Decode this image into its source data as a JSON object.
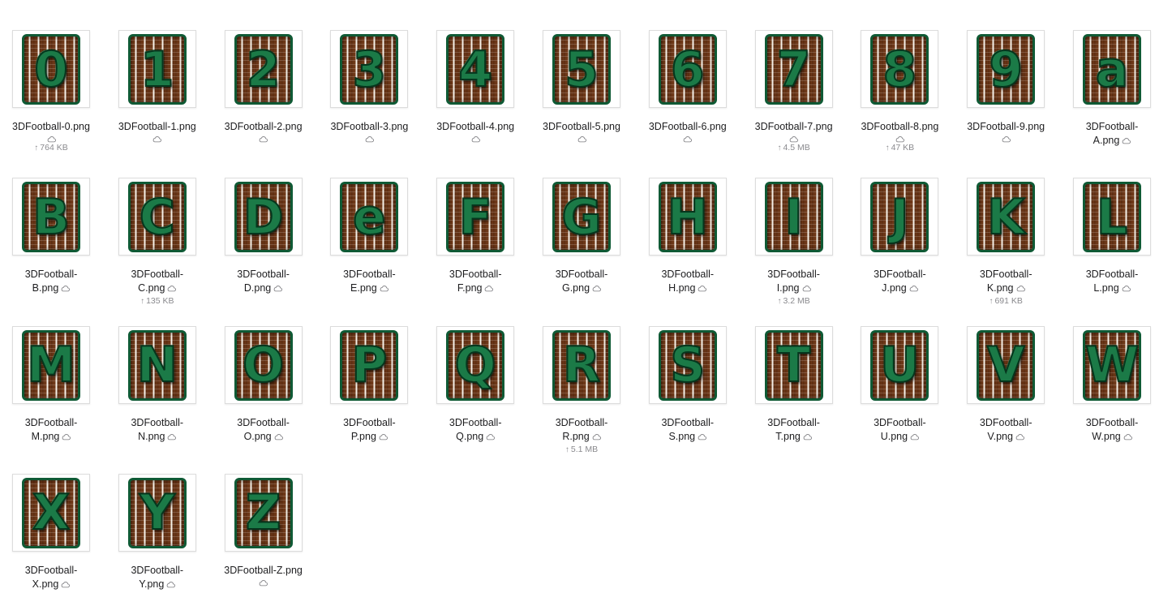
{
  "window": {
    "view": "icon-grid"
  },
  "colors": {
    "tile_green": "#1b7a47",
    "tile_brown": "#6e3818",
    "stitch": "#f5efe6",
    "meta_text": "#8a8a8e"
  },
  "icons": {
    "cloud": "cloud-icon",
    "upload": "upload-arrow-icon"
  },
  "files": [
    {
      "glyph": "0",
      "name": "3DFootball-0.png",
      "name_line1": "3DFootball-0.png",
      "name_line2": "",
      "size": "764 KB"
    },
    {
      "glyph": "1",
      "name": "3DFootball-1.png",
      "name_line1": "3DFootball-1.png",
      "name_line2": "",
      "size": ""
    },
    {
      "glyph": "2",
      "name": "3DFootball-2.png",
      "name_line1": "3DFootball-2.png",
      "name_line2": "",
      "size": ""
    },
    {
      "glyph": "3",
      "name": "3DFootball-3.png",
      "name_line1": "3DFootball-3.png",
      "name_line2": "",
      "size": ""
    },
    {
      "glyph": "4",
      "name": "3DFootball-4.png",
      "name_line1": "3DFootball-4.png",
      "name_line2": "",
      "size": ""
    },
    {
      "glyph": "5",
      "name": "3DFootball-5.png",
      "name_line1": "3DFootball-5.png",
      "name_line2": "",
      "size": ""
    },
    {
      "glyph": "6",
      "name": "3DFootball-6.png",
      "name_line1": "3DFootball-6.png",
      "name_line2": "",
      "size": ""
    },
    {
      "glyph": "7",
      "name": "3DFootball-7.png",
      "name_line1": "3DFootball-7.png",
      "name_line2": "",
      "size": "4.5 MB"
    },
    {
      "glyph": "8",
      "name": "3DFootball-8.png",
      "name_line1": "3DFootball-8.png",
      "name_line2": "",
      "size": "47 KB"
    },
    {
      "glyph": "9",
      "name": "3DFootball-9.png",
      "name_line1": "3DFootball-9.png",
      "name_line2": "",
      "size": ""
    },
    {
      "glyph": "a",
      "name": "3DFootball-A.png",
      "name_line1": "3DFootball-",
      "name_line2": "A.png",
      "size": ""
    },
    {
      "glyph": "B",
      "name": "3DFootball-B.png",
      "name_line1": "3DFootball-",
      "name_line2": "B.png",
      "size": ""
    },
    {
      "glyph": "C",
      "name": "3DFootball-C.png",
      "name_line1": "3DFootball-",
      "name_line2": "C.png",
      "size": "135 KB"
    },
    {
      "glyph": "D",
      "name": "3DFootball-D.png",
      "name_line1": "3DFootball-",
      "name_line2": "D.png",
      "size": ""
    },
    {
      "glyph": "e",
      "name": "3DFootball-E.png",
      "name_line1": "3DFootball-",
      "name_line2": "E.png",
      "size": ""
    },
    {
      "glyph": "F",
      "name": "3DFootball-F.png",
      "name_line1": "3DFootball-",
      "name_line2": "F.png",
      "size": ""
    },
    {
      "glyph": "G",
      "name": "3DFootball-G.png",
      "name_line1": "3DFootball-",
      "name_line2": "G.png",
      "size": ""
    },
    {
      "glyph": "H",
      "name": "3DFootball-H.png",
      "name_line1": "3DFootball-",
      "name_line2": "H.png",
      "size": ""
    },
    {
      "glyph": "I",
      "name": "3DFootball-I.png",
      "name_line1": "3DFootball-",
      "name_line2": "I.png",
      "size": "3.2 MB"
    },
    {
      "glyph": "J",
      "name": "3DFootball-J.png",
      "name_line1": "3DFootball-",
      "name_line2": "J.png",
      "size": ""
    },
    {
      "glyph": "K",
      "name": "3DFootball-K.png",
      "name_line1": "3DFootball-",
      "name_line2": "K.png",
      "size": "691 KB"
    },
    {
      "glyph": "L",
      "name": "3DFootball-L.png",
      "name_line1": "3DFootball-",
      "name_line2": "L.png",
      "size": ""
    },
    {
      "glyph": "M",
      "name": "3DFootball-M.png",
      "name_line1": "3DFootball-",
      "name_line2": "M.png",
      "size": ""
    },
    {
      "glyph": "N",
      "name": "3DFootball-N.png",
      "name_line1": "3DFootball-",
      "name_line2": "N.png",
      "size": ""
    },
    {
      "glyph": "O",
      "name": "3DFootball-O.png",
      "name_line1": "3DFootball-",
      "name_line2": "O.png",
      "size": ""
    },
    {
      "glyph": "P",
      "name": "3DFootball-P.png",
      "name_line1": "3DFootball-",
      "name_line2": "P.png",
      "size": ""
    },
    {
      "glyph": "Q",
      "name": "3DFootball-Q.png",
      "name_line1": "3DFootball-",
      "name_line2": "Q.png",
      "size": ""
    },
    {
      "glyph": "R",
      "name": "3DFootball-R.png",
      "name_line1": "3DFootball-",
      "name_line2": "R.png",
      "size": "5.1 MB"
    },
    {
      "glyph": "S",
      "name": "3DFootball-S.png",
      "name_line1": "3DFootball-",
      "name_line2": "S.png",
      "size": ""
    },
    {
      "glyph": "T",
      "name": "3DFootball-T.png",
      "name_line1": "3DFootball-",
      "name_line2": "T.png",
      "size": ""
    },
    {
      "glyph": "U",
      "name": "3DFootball-U.png",
      "name_line1": "3DFootball-",
      "name_line2": "U.png",
      "size": ""
    },
    {
      "glyph": "V",
      "name": "3DFootball-V.png",
      "name_line1": "3DFootball-",
      "name_line2": "V.png",
      "size": ""
    },
    {
      "glyph": "W",
      "name": "3DFootball-W.png",
      "name_line1": "3DFootball-",
      "name_line2": "W.png",
      "size": ""
    },
    {
      "glyph": "X",
      "name": "3DFootball-X.png",
      "name_line1": "3DFootball-",
      "name_line2": "X.png",
      "size": ""
    },
    {
      "glyph": "Y",
      "name": "3DFootball-Y.png",
      "name_line1": "3DFootball-",
      "name_line2": "Y.png",
      "size": ""
    },
    {
      "glyph": "Z",
      "name": "3DFootball-Z.png",
      "name_line1": "3DFootball-Z.png",
      "name_line2": "",
      "size": ""
    }
  ]
}
